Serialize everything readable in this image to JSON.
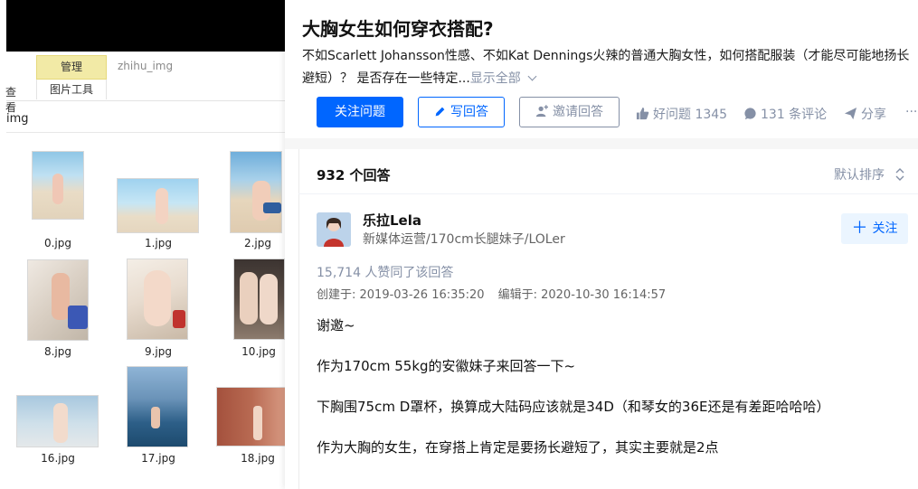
{
  "explorer": {
    "ribbon": {
      "manage_tab": "管理",
      "folder_label": "zhihu_img",
      "view_tab_partial": "查看",
      "picture_tools": "图片工具"
    },
    "address_partial": "img",
    "files": [
      {
        "name": "0.jpg"
      },
      {
        "name": "1.jpg"
      },
      {
        "name": "2.jpg"
      },
      {
        "name": "8.jpg"
      },
      {
        "name": "9.jpg"
      },
      {
        "name": "10.jpg"
      },
      {
        "name": "16.jpg"
      },
      {
        "name": "17.jpg"
      },
      {
        "name": "18.jpg"
      }
    ]
  },
  "question": {
    "title": "大胸女生如何穿衣搭配?",
    "description": "不如Scarlett Johansson性感、不如Kat Dennings火辣的普通大胸女性，如何搭配服装（才能尽可能地扬长避短）？ 是否存在一些特定...",
    "show_all": "显示全部",
    "follow_button": "关注问题",
    "write_button": "写回答",
    "invite_button": "邀请回答",
    "good_question": "好问题 1345",
    "comments": "131 条评论",
    "share": "分享",
    "more": "···"
  },
  "answers_header": {
    "count": "932 个回答",
    "sort": "默认排序"
  },
  "answer": {
    "author_name": "乐拉Lela",
    "author_bio": "新媒体运营/170cm长腿妹子/LOLer",
    "follow_button": "关注",
    "upvotes": "15,714 人赞同了该回答",
    "created": "创建于: 2019-03-26 16:35:20",
    "edited": "编辑于: 2020-10-30 16:14:57",
    "paragraphs": [
      "谢邀~",
      "作为170cm 55kg的安徽妹子来回答一下~",
      "下胸围75cm D罩杯，换算成大陆码应该就是34D（和琴女的36E还是有差距哈哈哈）",
      "作为大胸的女生，在穿搭上肯定是要扬长避短了，其实主要就是2点"
    ]
  },
  "colors": {
    "zhihu_blue": "#0066ff",
    "meta_gray": "#8590a6",
    "manage_tab_yellow": "#f2eaa6"
  }
}
